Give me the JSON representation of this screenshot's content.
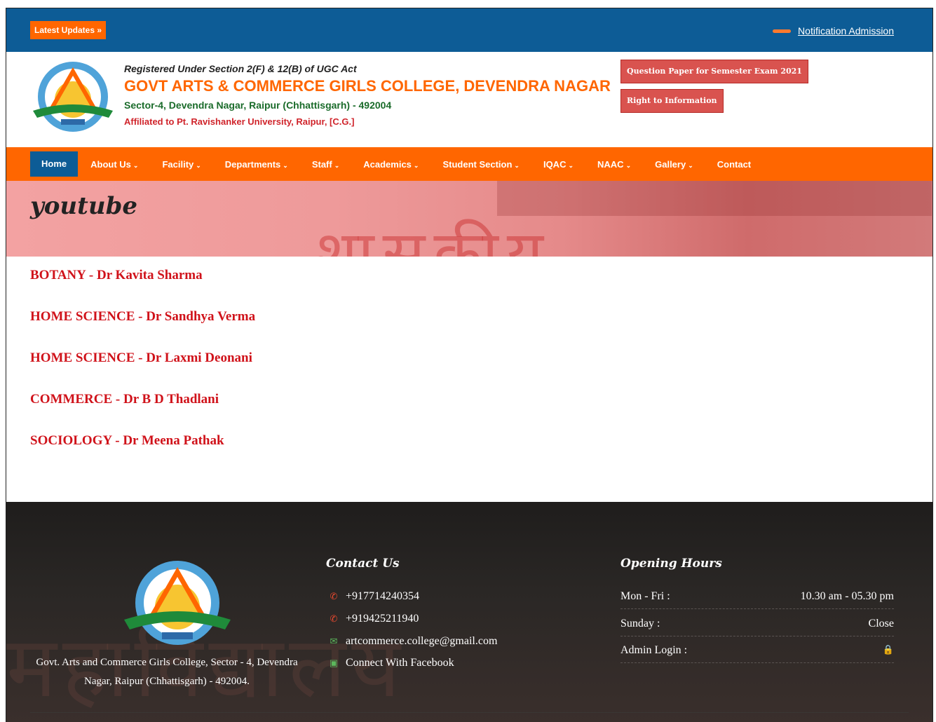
{
  "topbar": {
    "latest_label": "Latest Updates »",
    "notification_label": "Notification Admission"
  },
  "header": {
    "registered": "Registered Under Section 2(F) & 12(B) of UGC Act",
    "college_name": "GOVT ARTS & COMMERCE GIRLS COLLEGE, DEVENDRA NAGAR",
    "address": "Sector-4, Devendra Nagar, Raipur (Chhattisgarh) - 492004",
    "affiliation": "Affiliated to Pt. Ravishanker University, Raipur, [C.G.]",
    "question_paper_btn": "Question Paper for Semester Exam 2021",
    "rti_btn": "Right to Information"
  },
  "nav": {
    "items": [
      {
        "label": "Home",
        "dropdown": false
      },
      {
        "label": "About Us",
        "dropdown": true
      },
      {
        "label": "Facility",
        "dropdown": true
      },
      {
        "label": "Departments",
        "dropdown": true
      },
      {
        "label": "Staff",
        "dropdown": true
      },
      {
        "label": "Academics",
        "dropdown": true
      },
      {
        "label": "Student Section",
        "dropdown": true
      },
      {
        "label": "IQAC",
        "dropdown": true
      },
      {
        "label": "NAAC",
        "dropdown": true
      },
      {
        "label": "Gallery",
        "dropdown": true
      },
      {
        "label": "Contact",
        "dropdown": false
      }
    ]
  },
  "banner": {
    "title": "youtube"
  },
  "content": {
    "links": [
      "BOTANY - Dr Kavita Sharma",
      "HOME SCIENCE - Dr Sandhya Verma",
      "HOME SCIENCE - Dr Laxmi Deonani",
      "COMMERCE - Dr B D Thadlani",
      "SOCIOLOGY - Dr Meena Pathak"
    ]
  },
  "footer": {
    "address": "Govt. Arts and Commerce Girls College, Sector - 4, Devendra Nagar, Raipur (Chhattisgarh) - 492004.",
    "contact_heading": "Contact Us",
    "phone1": "+917714240354",
    "phone2": "+919425211940",
    "email": "artcommerce.college@gmail.com",
    "facebook": "Connect With Facebook",
    "hours_heading": "Opening Hours",
    "hours": [
      {
        "day": "Mon - Fri :",
        "time": "10.30 am - 05.30 pm"
      },
      {
        "day": "Sunday :",
        "time": "Close"
      }
    ],
    "admin_label": "Admin Login :"
  },
  "colors": {
    "primary_blue": "#0d5c96",
    "accent_orange": "#ff6600",
    "link_red": "#d0121a",
    "footer_bg": "#2a2725"
  }
}
